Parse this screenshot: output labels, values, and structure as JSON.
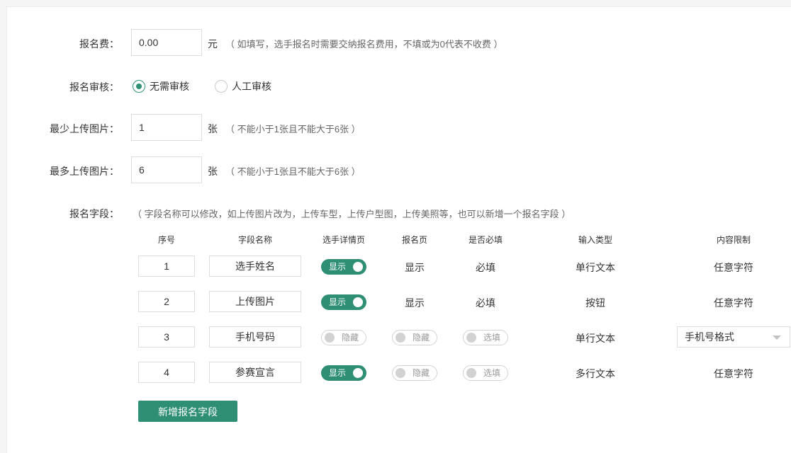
{
  "fee": {
    "label": "报名费：",
    "value": "0.00",
    "unit": "元",
    "hint": "（ 如填写，选手报名时需要交纳报名费用，不填或为0代表不收费 ）"
  },
  "review": {
    "label": "报名审核：",
    "options": [
      {
        "label": "无需审核",
        "checked": true
      },
      {
        "label": "人工审核",
        "checked": false
      }
    ]
  },
  "min_upload": {
    "label": "最少上传图片：",
    "value": "1",
    "unit": "张",
    "hint": "（ 不能小于1张且不能大于6张 ）"
  },
  "max_upload": {
    "label": "最多上传图片：",
    "value": "6",
    "unit": "张",
    "hint": "（ 不能小于1张且不能大于6张 ）"
  },
  "fields": {
    "label": "报名字段：",
    "hint": "（ 字段名称可以修改，如上传图片改为，上传车型，上传户型图，上传美照等，也可以新增一个报名字段 ）",
    "headers": [
      "序号",
      "字段名称",
      "选手详情页",
      "报名页",
      "是否必填",
      "输入类型",
      "内容限制"
    ],
    "rows": [
      {
        "index": "1",
        "name": "选手姓名",
        "detail": {
          "on": true,
          "label": "显示"
        },
        "signup_text": "显示",
        "required_text": "必填",
        "input_type": "单行文本",
        "limit_text": "任意字符"
      },
      {
        "index": "2",
        "name": "上传图片",
        "detail": {
          "on": true,
          "label": "显示"
        },
        "signup_text": "显示",
        "required_text": "必填",
        "input_type": "按钮",
        "limit_text": "任意字符"
      },
      {
        "index": "3",
        "name": "手机号码",
        "detail": {
          "on": false,
          "label": "隐藏"
        },
        "signup_switch": {
          "on": false,
          "label": "隐藏"
        },
        "required_switch": {
          "on": false,
          "label": "选填"
        },
        "input_type": "单行文本",
        "limit_select": "手机号格式"
      },
      {
        "index": "4",
        "name": "参赛宣言",
        "detail": {
          "on": true,
          "label": "显示"
        },
        "signup_switch": {
          "on": false,
          "label": "隐藏"
        },
        "required_switch": {
          "on": false,
          "label": "选填"
        },
        "input_type": "多行文本",
        "limit_text": "任意字符"
      }
    ]
  },
  "add_button": "新增报名字段",
  "colors": {
    "accent": "#2f8f74",
    "border": "#dddddd",
    "switch_off": "#d2d2d2"
  }
}
